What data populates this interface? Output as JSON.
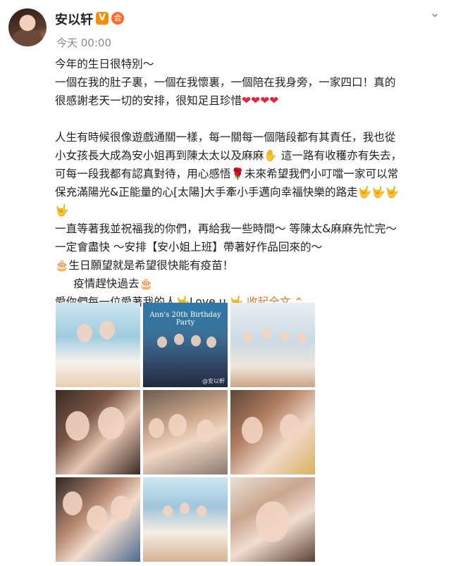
{
  "colors": {
    "accent": "#e0762b",
    "timestamp": "#8a8a8a",
    "text": "#222222",
    "verified_badge": "#ff8a00"
  },
  "post": {
    "user": {
      "name": "安以轩",
      "verified_badge": "V",
      "member_badge": "会",
      "avatar_icon": "avatar-photo"
    },
    "timestamp": "今天 00:00",
    "more_icon": "chevron-down-icon",
    "lines": [
      "今年的生日很特別～",
      "一個在我的肚子裏，一個在我懷裏，一個陪在我身旁，一家四口！真的",
      "很感謝老天一切的安排，很知足且珍惜",
      "",
      "人生有時候很像遊戲通關一樣，每一關每一個階段都有其責任，我也從",
      "小女孩長大成為安小姐再到陳太太以及麻麻",
      "這一路有收穫亦有失去，",
      "可每一段我都有認真對待，用心感悟",
      "未來希望我們小叮噹一家可以常",
      "保充滿陽光&正能量的心[太陽]大手牽小手邁向幸福快樂的路走",
      "一直等著我並祝福我的你們，再給我一些時間～ 等陳太&麻麻先忙完～",
      "一定會盡快 ～安排【安小姐上班】帶著好作品回來的～",
      "生日願望就是希望很快能有疫苗！",
      "疫情趕快過去",
      "愛你們每一位愛著我的人",
      "Love u"
    ],
    "collapse_label": "收起全文",
    "collapse_icon": "chevron-up-icon",
    "emojis": {
      "heart": "❤",
      "hand": "🤟",
      "rose": "🌹",
      "cake": "🎂"
    },
    "photos": [
      {
        "name": "photo-1"
      },
      {
        "name": "photo-2",
        "overlay_text": "Ann's 20th Birthday Party"
      },
      {
        "name": "photo-3"
      },
      {
        "name": "photo-4"
      },
      {
        "name": "photo-5"
      },
      {
        "name": "photo-6"
      },
      {
        "name": "photo-7"
      },
      {
        "name": "photo-8"
      },
      {
        "name": "photo-9"
      }
    ],
    "photo2_watermark": "@安以軒"
  }
}
